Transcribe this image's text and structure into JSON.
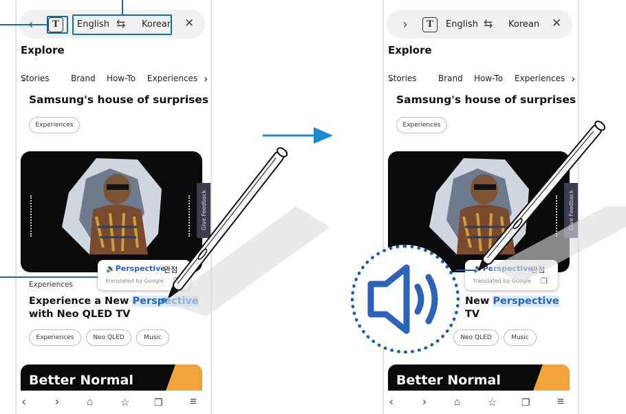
{
  "toolbar": {
    "back_icon": "chevron-left-icon",
    "forward_icon": "chevron-right-icon",
    "text_icon_glyph": "T",
    "source_lang": "English",
    "swap_icon": "swap-arrows-icon",
    "target_lang": "Korean",
    "close_icon": "close-icon"
  },
  "page": {
    "section_title": "Explore",
    "nav_tabs": [
      "Stories",
      "Brand",
      "How-To",
      "Experiences"
    ],
    "article1_title": "Samsung's house of surprises",
    "article1_chip": "Experiences",
    "feedback_tab": "Give Feedback",
    "article2_kicker": "Experiences",
    "article2_title_pre": "Experience a New ",
    "article2_title_hl": "Perspective",
    "article2_title_post": "with Neo QLED TV",
    "article2_chips": [
      "Experiences",
      "Neo QLED",
      "Music"
    ],
    "banner_text": "Better Normal"
  },
  "translation_popup": {
    "speaker_glyph": "🔉",
    "source_word": "Perspective",
    "translated_word": "관점",
    "credit": "translated by Google"
  },
  "right_panel": {
    "title2_left_pre": "New ",
    "title2_left_hl": "Perspective",
    "title2_line2_cut": "TV",
    "title1_cut": "Samsung's house of surprises"
  },
  "colors": {
    "accent_blue": "#0e6ea8",
    "arrow_blue": "#1a8ad4",
    "highlight_text": "#2c67b8",
    "highlight_bg": "#d7ebff",
    "banner_orange": "#f2a33c"
  }
}
